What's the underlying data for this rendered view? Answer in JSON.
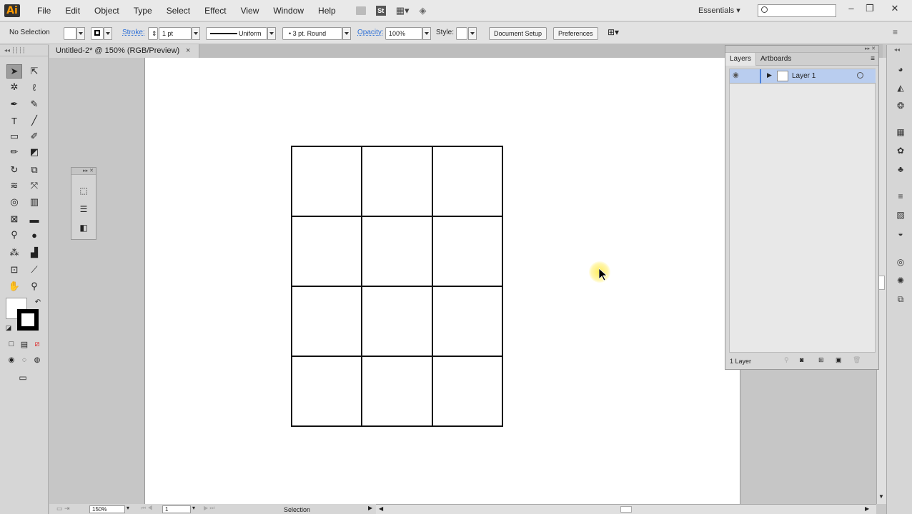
{
  "app": {
    "logo": "Ai"
  },
  "menu": [
    "File",
    "Edit",
    "Object",
    "Type",
    "Select",
    "Effect",
    "View",
    "Window",
    "Help"
  ],
  "workspace": {
    "label": "Essentials"
  },
  "search": {
    "placeholder": ""
  },
  "control_bar": {
    "selection_state": "No Selection",
    "stroke_label": "Stroke:",
    "stroke_weight": "1 pt",
    "profile": "Uniform",
    "brush": "3 pt. Round",
    "opacity_label": "Opacity:",
    "opacity_value": "100%",
    "style_label": "Style:",
    "document_setup": "Document Setup",
    "preferences": "Preferences"
  },
  "document": {
    "tab_title": "Untitled-2* @ 150% (RGB/Preview)",
    "close": "×"
  },
  "status_bar": {
    "zoom": "150%",
    "page": "1",
    "status": "Selection"
  },
  "layers_panel": {
    "tabs": [
      "Layers",
      "Artboards"
    ],
    "layers": [
      {
        "name": "Layer 1"
      }
    ],
    "footer_count": "1 Layer"
  },
  "artwork": {
    "grid_columns": 3,
    "grid_rows": 4
  },
  "colors": {
    "layer_highlight": "#b9cdef",
    "link_blue": "#2c6fd6",
    "artboard": "#ffffff"
  }
}
